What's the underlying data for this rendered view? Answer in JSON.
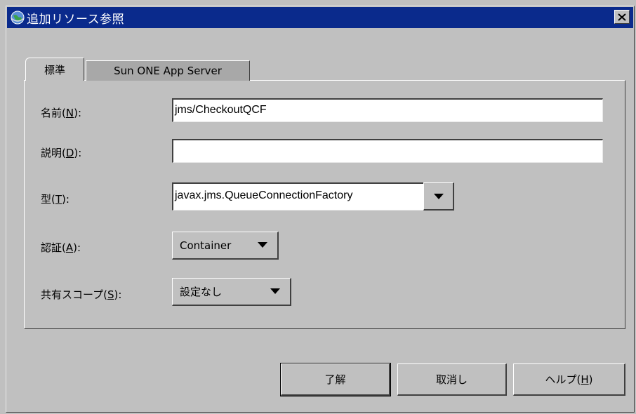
{
  "window": {
    "title": "追加リソース参照"
  },
  "tabs": [
    {
      "label": "標準",
      "active": true
    },
    {
      "label": "Sun ONE App Server",
      "active": false
    }
  ],
  "form": {
    "name": {
      "label_prefix": "名前(",
      "mnemonic": "N",
      "label_suffix": "):",
      "value": "jms/CheckoutQCF"
    },
    "description": {
      "label_prefix": "説明(",
      "mnemonic": "D",
      "label_suffix": "):",
      "value": ""
    },
    "type": {
      "label_prefix": "型(",
      "mnemonic": "T",
      "label_suffix": "):",
      "value": "javax.jms.QueueConnectionFactory"
    },
    "auth": {
      "label_prefix": "認証(",
      "mnemonic": "A",
      "label_suffix": "):",
      "value": "Container"
    },
    "sharing_scope": {
      "label_prefix": "共有スコープ(",
      "mnemonic": "S",
      "label_suffix": "):",
      "value": "設定なし"
    }
  },
  "buttons": {
    "ok": "了解",
    "cancel": "取消し",
    "help_prefix": "ヘルプ(",
    "help_mnemonic": "H",
    "help_suffix": ")"
  },
  "colors": {
    "titlebar": "#0a2a8c",
    "dialog_bg": "#c0c0c0"
  }
}
